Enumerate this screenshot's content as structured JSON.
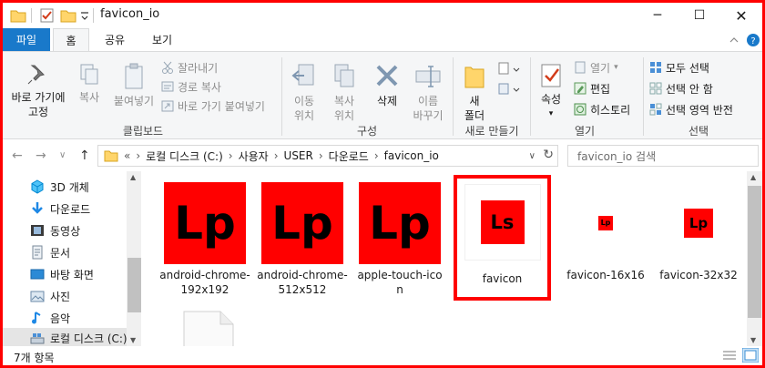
{
  "window": {
    "title": "favicon_io",
    "controls": {
      "minimize": "─",
      "maximize": "☐",
      "close": "✕"
    }
  },
  "tabs": {
    "file": "파일",
    "home": "홈",
    "share": "공유",
    "view": "보기"
  },
  "ribbon": {
    "clipboard": {
      "pin": [
        "바로 가기에",
        "고정"
      ],
      "copy": "복사",
      "paste": "붙여넣기",
      "cut": "잘라내기",
      "copy_path": "경로 복사",
      "paste_shortcut": "바로 가기 붙여넣기",
      "label": "클립보드"
    },
    "organize": {
      "move_to": [
        "이동",
        "위치"
      ],
      "copy_to": [
        "복사",
        "위치"
      ],
      "delete": "삭제",
      "rename": [
        "이름",
        "바꾸기"
      ],
      "label": "구성"
    },
    "new": {
      "new_folder": [
        "새",
        "폴더"
      ],
      "label": "새로 만들기"
    },
    "open": {
      "properties": "속성",
      "open": "열기",
      "edit": "편집",
      "history": "히스토리",
      "label": "열기"
    },
    "select": {
      "select_all": "모두 선택",
      "select_none": "선택 안 함",
      "invert": "선택 영역 반전",
      "label": "선택"
    }
  },
  "address": {
    "overflow": "«",
    "crumbs": [
      "로컬 디스크 (C:)",
      "사용자",
      "USER",
      "다운로드",
      "favicon_io"
    ],
    "search_placeholder": "favicon_io 검색"
  },
  "sidebar": {
    "items": [
      {
        "label": "3D 개체",
        "icon": "cube-icon"
      },
      {
        "label": "다운로드",
        "icon": "download-icon"
      },
      {
        "label": "동영상",
        "icon": "film-icon"
      },
      {
        "label": "문서",
        "icon": "document-icon"
      },
      {
        "label": "바탕 화면",
        "icon": "desktop-icon"
      },
      {
        "label": "사진",
        "icon": "picture-icon"
      },
      {
        "label": "음악",
        "icon": "music-icon"
      },
      {
        "label": "로컬 디스크 (C:)",
        "icon": "drive-icon"
      }
    ]
  },
  "files": [
    {
      "name": [
        "android-chrome-",
        "192x192"
      ],
      "thumb_text": "Lp"
    },
    {
      "name": [
        "android-chrome-",
        "512x512"
      ],
      "thumb_text": "Lp"
    },
    {
      "name": [
        "apple-touch-ico",
        "n"
      ],
      "thumb_text": "Lp"
    },
    {
      "name": [
        "favicon"
      ],
      "thumb_text": "Ls"
    },
    {
      "name": [
        "favicon-16x16"
      ],
      "thumb_text": "Lp"
    },
    {
      "name": [
        "favicon-32x32"
      ],
      "thumb_text": "Lp"
    },
    {
      "name": [
        ""
      ],
      "thumb_text": ""
    }
  ],
  "status": {
    "item_count": "7개 항목"
  },
  "colors": {
    "accent": "#1979ca",
    "thumb_red": "#ff0000",
    "highlight": "#ff0000"
  }
}
